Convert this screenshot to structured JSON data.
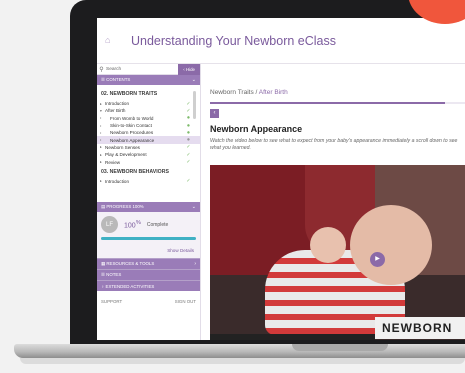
{
  "header": {
    "title": "Understanding Your Newborn eClass",
    "home_icon": "home-icon"
  },
  "sidebar": {
    "search_placeholder": "Search",
    "hide_label": "‹ Hide",
    "contents_label": "☰ CONTENTS",
    "sections": [
      {
        "heading": "02. NEWBORN TRAITS",
        "items": [
          {
            "label": "Introduction",
            "arrow": "▸",
            "mark": "check"
          },
          {
            "label": "After Birth",
            "arrow": "▾",
            "mark": "check"
          },
          {
            "label": "From Womb to World",
            "arrow": "•",
            "mark": "dot",
            "sub": true
          },
          {
            "label": "Skin-to-Skin Contact",
            "arrow": "•",
            "mark": "dot",
            "sub": true
          },
          {
            "label": "Newborn Procedures",
            "arrow": "•",
            "mark": "dot",
            "sub": true
          },
          {
            "label": "Newborn Appearance",
            "arrow": "•",
            "mark": "dot-grey",
            "sub": true,
            "active": true
          },
          {
            "label": "Newborn Senses",
            "arrow": "▸",
            "mark": "check"
          },
          {
            "label": "Play & Development",
            "arrow": "▸",
            "mark": "check"
          },
          {
            "label": "Review",
            "arrow": "▸",
            "mark": "check"
          }
        ]
      },
      {
        "heading": "03. NEWBORN BEHAVIORS",
        "items": [
          {
            "label": "Introduction",
            "arrow": "▸",
            "mark": "check"
          }
        ]
      }
    ],
    "progress_label": "▤ PROGRESS 100%",
    "avatar_initials": "LF",
    "progress_pct": "100",
    "progress_sup": "%",
    "complete_label": "Complete",
    "progress_fraction": 1.0,
    "show_details": "Show Details",
    "resources_label": "▦ RESOURCES & TOOLS",
    "notes_label": "☰ NOTES",
    "extended_label": "♀ EXTENDED ACTIVITIES",
    "support": "SUPPORT",
    "signout": "SIGN OUT"
  },
  "main": {
    "breadcrumb_root": "Newborn Traits",
    "breadcrumb_sep": " / ",
    "breadcrumb_current": "After Birth",
    "back_label": "‹",
    "title": "Newborn Appearance",
    "intro": "Watch the video below to see what to expect from your baby's appearance immediately a scroll down to see what you learned.",
    "video_banner": "NEWBORN",
    "play_label": "▶"
  },
  "colors": {
    "accent": "#8b6aa8",
    "orange": "#f0563c",
    "progress": "#3fb1c4"
  }
}
